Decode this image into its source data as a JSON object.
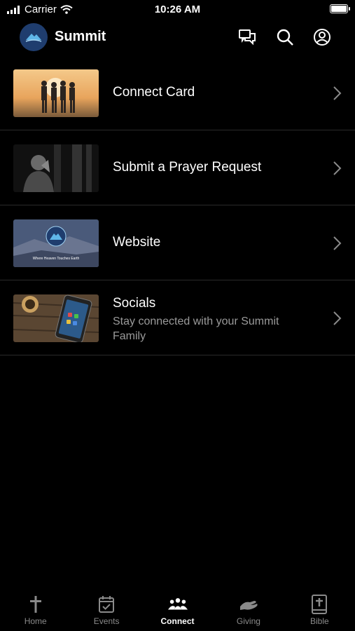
{
  "status": {
    "carrier": "Carrier",
    "time": "10:26 AM"
  },
  "header": {
    "title": "Summit"
  },
  "items": [
    {
      "title": "Connect Card",
      "subtitle": ""
    },
    {
      "title": "Submit a Prayer Request",
      "subtitle": ""
    },
    {
      "title": "Website",
      "subtitle": "",
      "thumb_caption": "Where Heaven Touches Earth"
    },
    {
      "title": "Socials",
      "subtitle": "Stay connected with your Summit Family"
    }
  ],
  "tabs": [
    {
      "label": "Home",
      "icon": "cross-icon",
      "active": false
    },
    {
      "label": "Events",
      "icon": "calendar-check-icon",
      "active": false
    },
    {
      "label": "Connect",
      "icon": "people-icon",
      "active": true
    },
    {
      "label": "Giving",
      "icon": "hand-icon",
      "active": false
    },
    {
      "label": "Bible",
      "icon": "bible-icon",
      "active": false
    }
  ],
  "colors": {
    "background": "#000000",
    "divider": "#2a2a2a",
    "inactive": "#8a8a8a",
    "logo": "#1f3d6e"
  }
}
